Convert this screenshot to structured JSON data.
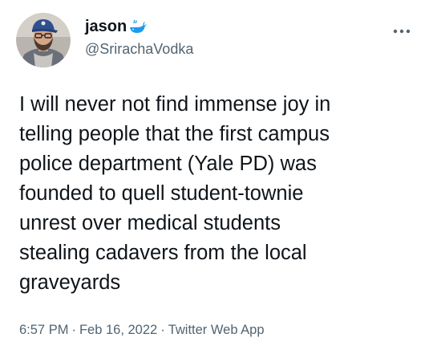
{
  "user": {
    "display_name": "jason",
    "handle": "@SrirachaVodka",
    "badge_icon": "whale-icon",
    "avatar_icon": "avatar"
  },
  "tweet": {
    "text": "I will never not find immense joy in\ntelling people that the first campus\npolice department (Yale PD) was\nfounded to quell student-townie\nunrest over medical students\nstealing cadavers from the local\ngraveyards",
    "time": "6:57 PM",
    "date": "Feb 16, 2022",
    "source": "Twitter Web App",
    "separator": "·"
  },
  "menu": {
    "icon": "more-icon"
  },
  "colors": {
    "text": "#0f1419",
    "secondary": "#536471",
    "whale": "#1d9bf0"
  }
}
